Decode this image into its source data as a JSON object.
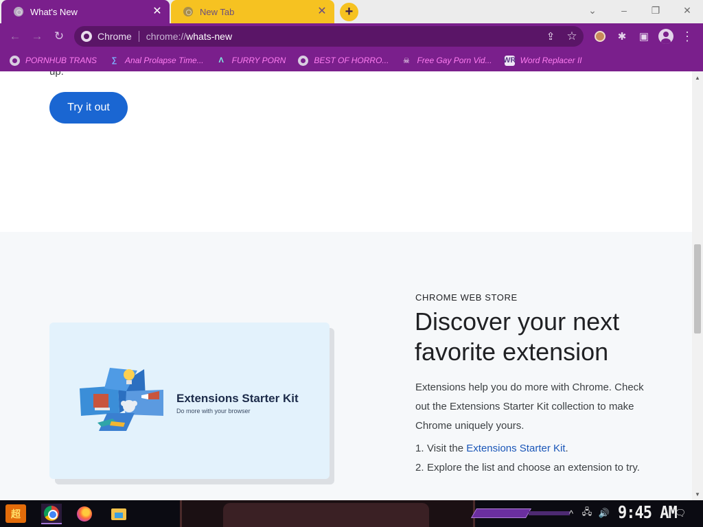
{
  "tabs": [
    {
      "title": "What's New",
      "active": true,
      "favicon": "chrome-globe-icon"
    },
    {
      "title": "New Tab",
      "active": false,
      "favicon": "chrome-globe-icon"
    }
  ],
  "tab_close_glyph": "✕",
  "new_tab_glyph": "+",
  "window_controls": {
    "tab_search": "⌄",
    "minimize": "–",
    "restore": "❐",
    "close": "✕"
  },
  "toolbar": {
    "back": "←",
    "forward": "→",
    "reload": "↻",
    "omnibox": {
      "origin_label": "Chrome",
      "scheme": "chrome://",
      "host": "whats-new"
    },
    "share": "⇪",
    "star": "☆",
    "extensions": "✱",
    "side_panel": "▣",
    "menu": "⋮"
  },
  "bookmarks": [
    {
      "label": "PORNHUB TRANS",
      "icon": "globe-icon"
    },
    {
      "label": "Anal Prolapse Time...",
      "icon": "v-logo-icon"
    },
    {
      "label": "FURRY PORN",
      "icon": "lambda-logo-icon"
    },
    {
      "label": "BEST OF HORRO...",
      "icon": "globe-icon"
    },
    {
      "label": "Free Gay Porn Vid...",
      "icon": "ghost-icon"
    },
    {
      "label": "Word Replacer II",
      "icon": "wr-logo-icon"
    }
  ],
  "bookmark_glyphs": {
    "v": "∑",
    "lambda": "Λ",
    "ghost": "☠",
    "wr": "WR"
  },
  "page": {
    "top_fragment": "up.",
    "try_button": "Try it out",
    "store": {
      "eyebrow": "CHROME WEB STORE",
      "headline": "Discover your next favorite extension",
      "body": "Extensions help you do more with Chrome. Check out the Extensions Starter Kit collection to make Chrome uniquely yours.",
      "steps": [
        {
          "num": "1.",
          "before": "Visit the ",
          "link": "Extensions Starter Kit",
          "after": "."
        },
        {
          "num": "2.",
          "text": "Explore the list and choose an extension to try."
        }
      ],
      "card": {
        "title": "Extensions Starter Kit",
        "subtitle": "Do more with your browser"
      }
    }
  },
  "scrollbar": {
    "up": "▲",
    "down": "▼"
  },
  "taskbar": {
    "start_glyph": "超",
    "apps": [
      "chrome-icon",
      "firefox-icon",
      "file-explorer-icon"
    ],
    "tray": {
      "overflow": "^",
      "network": "🖧",
      "volume": "🔊",
      "notifications": "🗨"
    },
    "clock": "9:45 AM"
  },
  "colors": {
    "theme_purple": "#7a1f8c",
    "tab_yellow": "#f6c221",
    "bookmark_pink": "#ff7ef2",
    "button_blue": "#1a66d2",
    "link_blue": "#1a56b8"
  }
}
